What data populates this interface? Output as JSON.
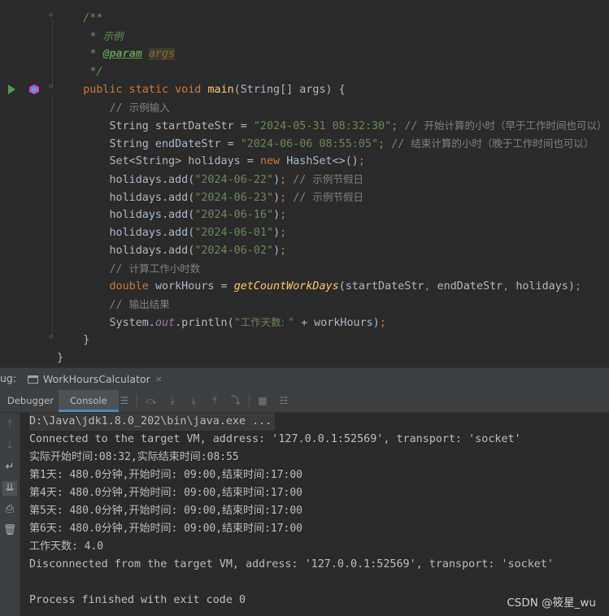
{
  "editor": {
    "lines": [
      {
        "indent": "    ",
        "parts": [
          {
            "t": "/**",
            "c": "doc"
          }
        ]
      },
      {
        "indent": "     ",
        "parts": [
          {
            "t": "* ",
            "c": "doc"
          },
          {
            "t": "示例",
            "c": "doc cjk"
          }
        ]
      },
      {
        "indent": "     ",
        "parts": [
          {
            "t": "* ",
            "c": "doc"
          },
          {
            "t": "@param",
            "c": "tag"
          },
          {
            "t": " ",
            "c": "doc"
          },
          {
            "t": "args",
            "c": "docarg"
          }
        ]
      },
      {
        "indent": "     ",
        "parts": [
          {
            "t": "*/",
            "c": "doc"
          }
        ]
      },
      {
        "indent": "    ",
        "parts": [
          {
            "t": "public static void ",
            "c": "k"
          },
          {
            "t": "main",
            "c": "fn"
          },
          {
            "t": "(String[] args) {",
            "c": ""
          }
        ]
      },
      {
        "indent": "        ",
        "parts": [
          {
            "t": "// ",
            "c": "c"
          },
          {
            "t": "示例输入",
            "c": "c cjk"
          }
        ]
      },
      {
        "indent": "        ",
        "parts": [
          {
            "t": "String startDateStr = ",
            "c": ""
          },
          {
            "t": "\"2024-05-31 08:32:30\"",
            "c": "s"
          },
          {
            "t": "; ",
            "c": "k"
          },
          {
            "t": "// ",
            "c": "c"
          },
          {
            "t": "开始计算的小时（早于工作时间也可以）",
            "c": "c cjk"
          }
        ]
      },
      {
        "indent": "        ",
        "parts": [
          {
            "t": "String endDateStr = ",
            "c": ""
          },
          {
            "t": "\"2024-06-06 08:55:05\"",
            "c": "s"
          },
          {
            "t": "; ",
            "c": "k"
          },
          {
            "t": "// ",
            "c": "c"
          },
          {
            "t": "结束计算的小时（晚于工作时间也可以）",
            "c": "c cjk"
          }
        ]
      },
      {
        "indent": "        ",
        "parts": [
          {
            "t": "Set<String> holidays = ",
            "c": ""
          },
          {
            "t": "new ",
            "c": "k"
          },
          {
            "t": "HashSet<>()",
            "c": ""
          },
          {
            "t": ";",
            "c": "k"
          }
        ]
      },
      {
        "indent": "        ",
        "parts": [
          {
            "t": "holidays.add(",
            "c": ""
          },
          {
            "t": "\"2024-06-22\"",
            "c": "s"
          },
          {
            "t": ")",
            "c": ""
          },
          {
            "t": "; ",
            "c": "k"
          },
          {
            "t": "// ",
            "c": "c"
          },
          {
            "t": "示例节假日",
            "c": "c cjk"
          }
        ]
      },
      {
        "indent": "        ",
        "parts": [
          {
            "t": "holidays.add(",
            "c": ""
          },
          {
            "t": "\"2024-06-23\"",
            "c": "s"
          },
          {
            "t": ")",
            "c": ""
          },
          {
            "t": "; ",
            "c": "k"
          },
          {
            "t": "// ",
            "c": "c"
          },
          {
            "t": "示例节假日",
            "c": "c cjk"
          }
        ]
      },
      {
        "indent": "        ",
        "parts": [
          {
            "t": "holidays.add(",
            "c": ""
          },
          {
            "t": "\"2024-06-16\"",
            "c": "s"
          },
          {
            "t": ")",
            "c": ""
          },
          {
            "t": ";",
            "c": "k"
          }
        ]
      },
      {
        "indent": "        ",
        "parts": [
          {
            "t": "holidays.add(",
            "c": ""
          },
          {
            "t": "\"2024-06-01\"",
            "c": "s"
          },
          {
            "t": ")",
            "c": ""
          },
          {
            "t": ";",
            "c": "k"
          }
        ]
      },
      {
        "indent": "        ",
        "parts": [
          {
            "t": "holidays.add(",
            "c": ""
          },
          {
            "t": "\"2024-06-02\"",
            "c": "s"
          },
          {
            "t": ")",
            "c": ""
          },
          {
            "t": ";",
            "c": "k"
          }
        ]
      },
      {
        "indent": "        ",
        "parts": [
          {
            "t": "// ",
            "c": "c"
          },
          {
            "t": "计算工作小时数",
            "c": "c cjk"
          }
        ]
      },
      {
        "indent": "        ",
        "parts": [
          {
            "t": "double ",
            "c": "k"
          },
          {
            "t": "workHours = ",
            "c": ""
          },
          {
            "t": "getCountWorkDays",
            "c": "sfn"
          },
          {
            "t": "(startDateStr",
            "c": ""
          },
          {
            "t": ", ",
            "c": "k"
          },
          {
            "t": "endDateStr",
            "c": ""
          },
          {
            "t": ", ",
            "c": "k"
          },
          {
            "t": "holidays)",
            "c": ""
          },
          {
            "t": ";",
            "c": "k"
          }
        ]
      },
      {
        "indent": "        ",
        "parts": [
          {
            "t": "// ",
            "c": "c"
          },
          {
            "t": "输出结果",
            "c": "c cjk"
          }
        ]
      },
      {
        "indent": "        ",
        "parts": [
          {
            "t": "System.",
            "c": ""
          },
          {
            "t": "out",
            "c": "static"
          },
          {
            "t": ".println(",
            "c": ""
          },
          {
            "t": "\"",
            "c": "s"
          },
          {
            "t": "工作天数: ",
            "c": "s cjk"
          },
          {
            "t": "\" ",
            "c": "s"
          },
          {
            "t": "+ workHours)",
            "c": ""
          },
          {
            "t": ";",
            "c": "k"
          }
        ]
      },
      {
        "indent": "    ",
        "parts": [
          {
            "t": "}",
            "c": ""
          }
        ]
      },
      {
        "indent": "",
        "parts": [
          {
            "t": "}",
            "c": ""
          }
        ]
      }
    ]
  },
  "debug": {
    "label": "ug:",
    "session_tab": "WorkHoursCalculator",
    "close_glyph": "×",
    "tabs": {
      "debugger": "Debugger",
      "console": "Console"
    }
  },
  "console": {
    "command": "D:\\Java\\jdk1.8.0_202\\bin\\java.exe ...",
    "lines": [
      "Connected to the target VM, address: '127.0.0.1:52569', transport: 'socket'",
      "实际开始时间:08:32,实际结束时间:08:55",
      "第1天: 480.0分钟,开始时间: 09:00,结束时间:17:00",
      "第4天: 480.0分钟,开始时间: 09:00,结束时间:17:00",
      "第5天: 480.0分钟,开始时间: 09:00,结束时间:17:00",
      "第6天: 480.0分钟,开始时间: 09:00,结束时间:17:00",
      "工作天数: 4.0",
      "Disconnected from the target VM, address: '127.0.0.1:52569', transport: 'socket'",
      "",
      "Process finished with exit code 0"
    ]
  },
  "watermark": "CSDN @筱星_wu",
  "colors": {
    "keyword": "#cc7832",
    "string": "#6a8759",
    "comment": "#808080",
    "javadoc": "#629755",
    "method": "#ffc66d",
    "text": "#a9b7c6",
    "background": "#2b2b2b",
    "run": "#499c54"
  }
}
